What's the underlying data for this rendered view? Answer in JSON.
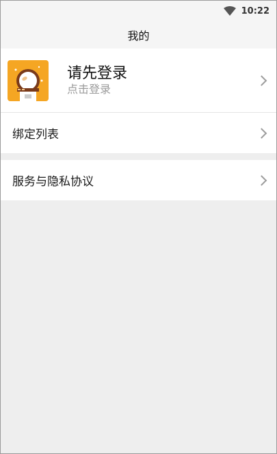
{
  "status_bar": {
    "time": "10:22",
    "wifi_icon": "wifi-icon"
  },
  "header": {
    "title": "我的"
  },
  "profile": {
    "title": "请先登录",
    "subtitle": "点击登录",
    "avatar_icon": "cartoon-avatar-icon"
  },
  "menu": {
    "items": [
      {
        "label": "绑定列表"
      },
      {
        "label": "服务与隐私协议"
      }
    ]
  },
  "colors": {
    "avatar_bg": "#f5a623",
    "background": "#eeeeee",
    "row_bg": "#ffffff",
    "secondary_text": "#9a9a9a"
  }
}
